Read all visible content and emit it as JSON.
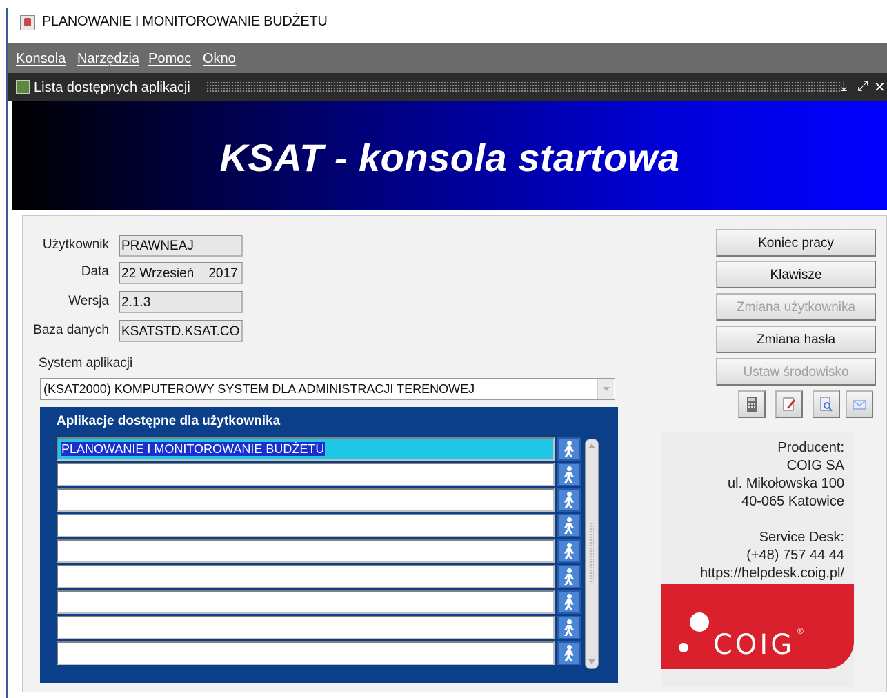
{
  "titlebar": {
    "title": "PLANOWANIE I MONITOROWANIE BUDŻETU"
  },
  "menu": [
    {
      "label": "Konsola"
    },
    {
      "label": "Narzędzia"
    },
    {
      "label": "Pomoc"
    },
    {
      "label": "Okno"
    }
  ],
  "window": {
    "title": "Lista dostępnych aplikacji",
    "controls": [
      "⤓",
      "⤢",
      "✕"
    ]
  },
  "banner": {
    "title": "KSAT - konsola startowa"
  },
  "form": {
    "user_label": "Użytkownik",
    "user_value": "PRAWNEAJ",
    "date_label": "Data",
    "date_value": "22 Wrzesień    2017",
    "version_label": "Wersja",
    "version_value": "2.1.3",
    "db_label": "Baza danych",
    "db_value": "KSATSTD.KSAT.COIG",
    "system_label": "System aplikacji",
    "system_value": "(KSAT2000) KOMPUTEROWY SYSTEM DLA ADMINISTRACJI TERENOWEJ"
  },
  "apps": {
    "title": "Aplikacje dostępne dla użytkownika",
    "rows": [
      "PLANOWANIE I MONITOROWANIE BUDŻETU",
      "",
      "",
      "",
      "",
      "",
      "",
      "",
      ""
    ]
  },
  "buttons": {
    "end": "Koniec pracy",
    "keys": "Klawisze",
    "change_user": "Zmiana użytkownika",
    "change_password": "Zmiana hasła",
    "set_env": "Ustaw środowisko"
  },
  "producer": {
    "label": "Producent:",
    "name": "COIG SA",
    "street": "ul. Mikołowska 100",
    "city": "40-065 Katowice",
    "desk_label": "Service Desk:",
    "phone": "(+48) 757 44 44",
    "url": "https://helpdesk.coig.pl/"
  },
  "logo": {
    "text": "COIG",
    "mark": "®"
  },
  "colors": {
    "banner_start": "#000000",
    "banner_end": "#0000ff",
    "apps_bg": "#0b3f8a",
    "selected": "#1fc7e6",
    "logo_red": "#d9202c"
  },
  "icons": [
    "calculator-icon",
    "edit-icon",
    "document-search-icon",
    "mail-icon",
    "run-icon"
  ]
}
